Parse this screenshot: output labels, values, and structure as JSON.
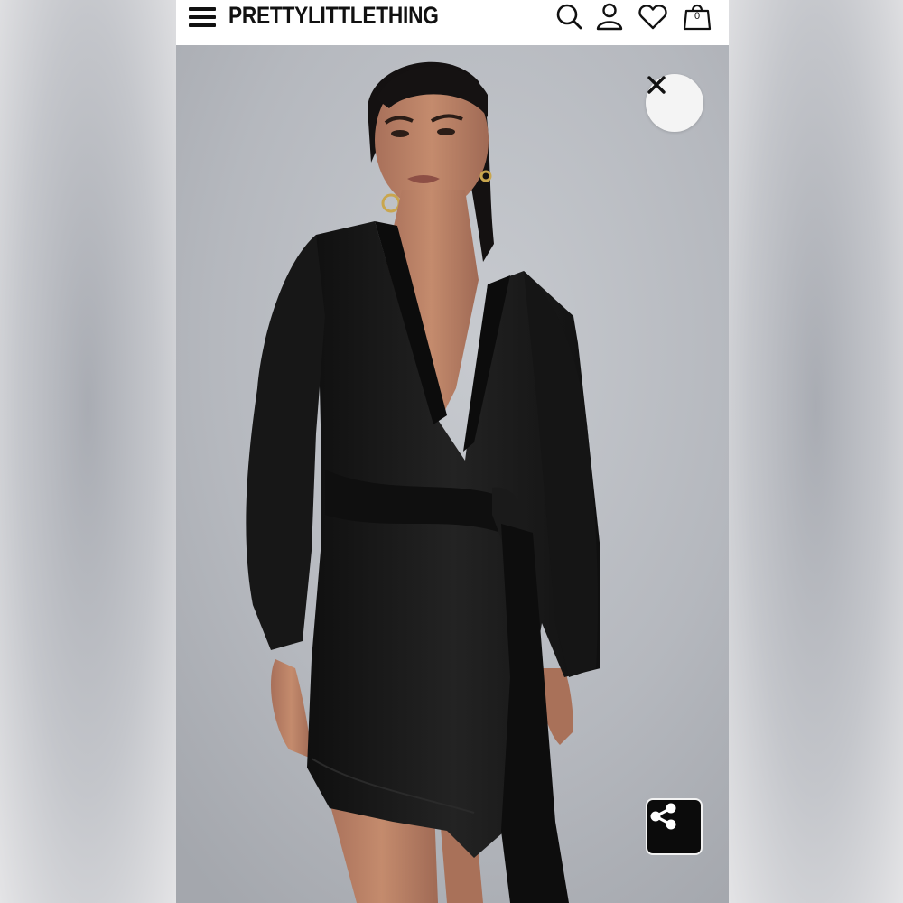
{
  "header": {
    "brand": "PRETTYLITTLETHING",
    "menu_icon": "hamburger-menu-icon",
    "search_icon": "search-icon",
    "account_icon": "account-icon",
    "wishlist_icon": "heart-icon",
    "bag_icon": "shopping-bag-icon",
    "bag_count": "0"
  },
  "gallery": {
    "close_icon": "close-icon",
    "share_icon": "share-icon",
    "image": "product-photo-black-blazer-dress"
  },
  "colors": {
    "header_bg": "#ffffff",
    "text": "#111111",
    "photo_bg": "#b3b6bc",
    "garment": "#151515",
    "skin": "#b97f63",
    "share_bg": "#0b0b0b",
    "close_bg": "#f4f4f4"
  }
}
